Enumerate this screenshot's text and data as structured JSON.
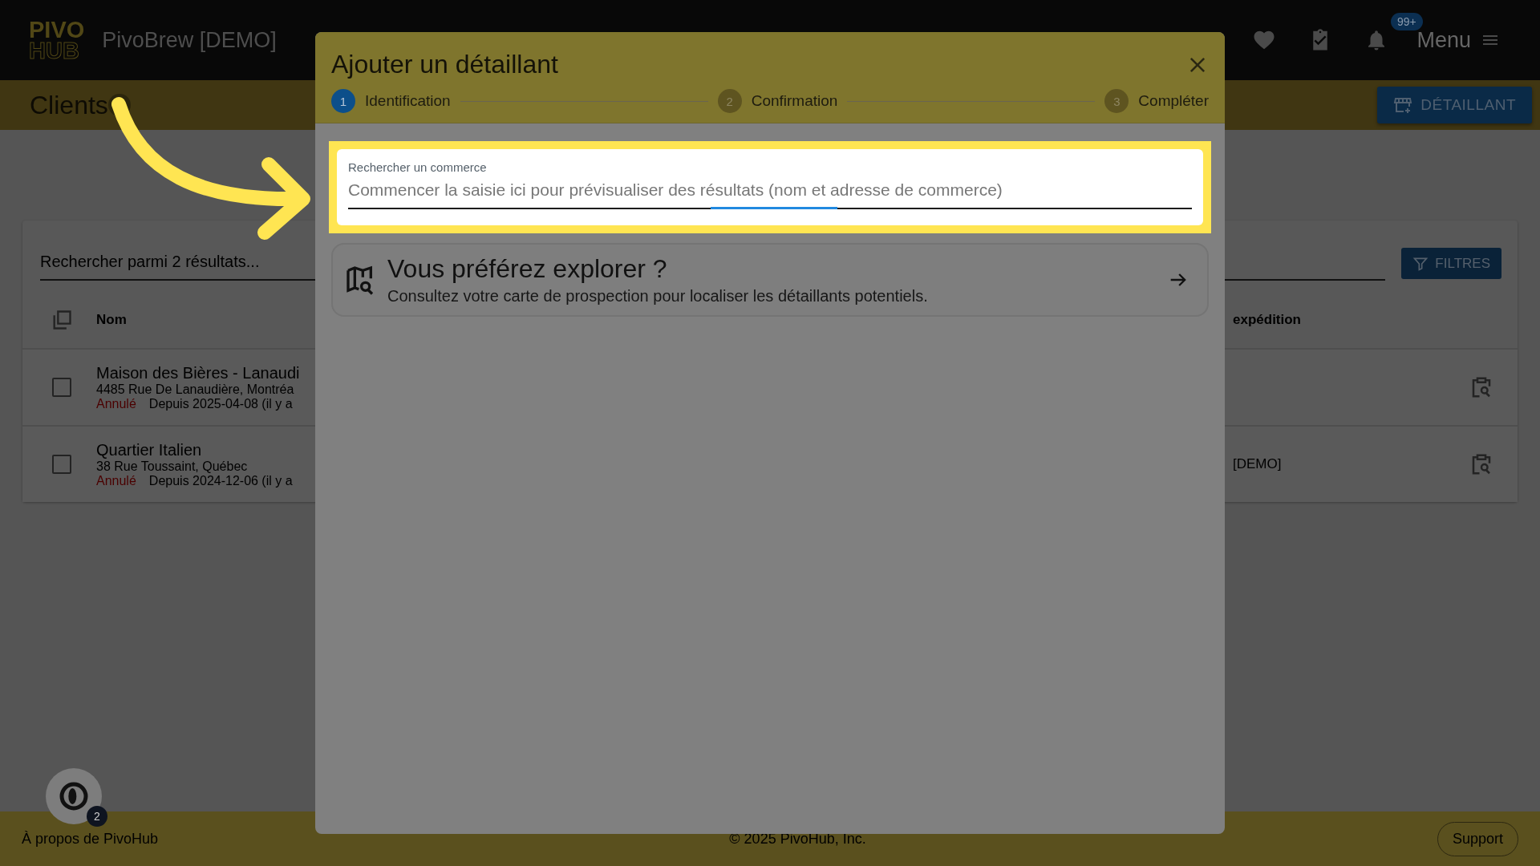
{
  "top_bar": {
    "logo": [
      "PIVO",
      "HUB"
    ],
    "title": "PivoBrew [DEMO]",
    "notification_badge": "99+",
    "menu_label": "Menu"
  },
  "page_header": {
    "title": "Clients",
    "add_button": "DÉTAILLANT"
  },
  "list": {
    "search_placeholder": "Rechercher parmi 2 résultats...",
    "filters_button": "FILTRES",
    "columns": [
      "Nom",
      "expédition"
    ],
    "rows": [
      {
        "checked": false,
        "name": "Maison des Bières - Lanaudi",
        "address": "4485 Rue De Lanaudière, Montréa",
        "status": "Annulé",
        "since": "Depuis 2025-04-08 (il y a"
      },
      {
        "checked": false,
        "name": "Quartier Italien",
        "address": "38 Rue Toussaint, Québec",
        "status": "Annulé",
        "since": "Depuis 2024-12-06 (il y a",
        "column_2": "[DEMO]"
      }
    ]
  },
  "modal": {
    "title": "Ajouter un détaillant",
    "steps": [
      {
        "number": "1",
        "label": "Identification",
        "selected": true
      },
      {
        "number": "2",
        "label": "Confirmation",
        "selected": false
      },
      {
        "number": "3",
        "label": "Compléter",
        "selected": false
      }
    ],
    "search": {
      "label": "Rechercher un commerce",
      "placeholder": "Commencer la saisie ici pour prévisualiser des résultats (nom et adresse de commerce)"
    },
    "explore": {
      "title": "Vous préférez explorer ?",
      "text": "Consultez votre carte de prospection pour localiser les détaillants potentiels."
    }
  },
  "chat_badge": "2",
  "footer": {
    "about": "À propos de PivoHub",
    "copyright": "© 2025 PivoHub, Inc.",
    "support": "Support"
  }
}
